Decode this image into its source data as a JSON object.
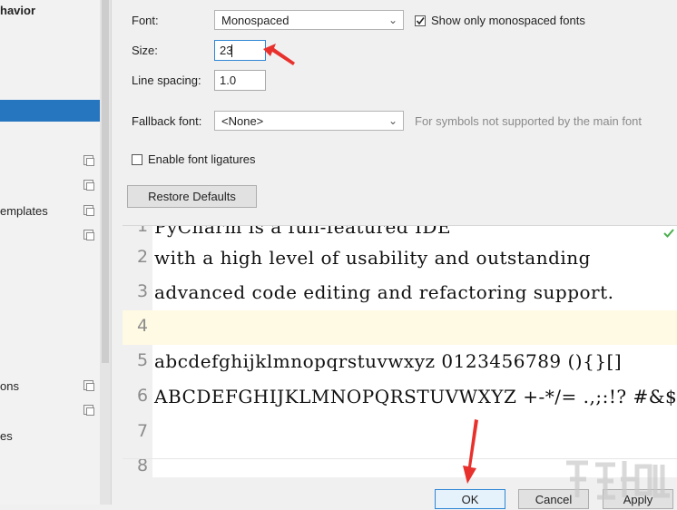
{
  "sidebar": {
    "items": [
      {
        "label": "havior"
      },
      {
        "label": "emplates"
      },
      {
        "label": "ons"
      },
      {
        "label": "es"
      }
    ]
  },
  "font": {
    "label": "Font:",
    "value": "Monospaced",
    "monospaced_only_label": "Show only monospaced fonts",
    "monospaced_only_checked": true
  },
  "size": {
    "label": "Size:",
    "value": "23"
  },
  "line_spacing": {
    "label": "Line spacing:",
    "value": "1.0"
  },
  "fallback": {
    "label": "Fallback font:",
    "value": "<None>",
    "hint": "For symbols not supported by the main font"
  },
  "ligatures": {
    "label": "Enable font ligatures",
    "checked": false
  },
  "restore_button": "Restore Defaults",
  "preview": {
    "lines": [
      {
        "number": "1",
        "text": "PyCharm is a full-featured IDE"
      },
      {
        "number": "2",
        "text": "with a high level of usability and outstanding"
      },
      {
        "number": "3",
        "text": "advanced code editing and refactoring support."
      },
      {
        "number": "4",
        "text": ""
      },
      {
        "number": "5",
        "text": "abcdefghijklmnopqrstuvwxyz 0123456789 (){}[]"
      },
      {
        "number": "6",
        "text": "ABCDEFGHIJKLMNOPQRSTUVWXYZ +-*/= .,;:!? #&$%@|^"
      },
      {
        "number": "7",
        "text": ""
      },
      {
        "number": "8",
        "text": ""
      }
    ],
    "current_line": "4"
  },
  "buttons": {
    "ok": "OK",
    "cancel": "Cancel",
    "apply": "Apply"
  },
  "colors": {
    "selection": "#2675bf",
    "annotation_arrow": "#e8312c",
    "current_line": "#fffae3"
  }
}
